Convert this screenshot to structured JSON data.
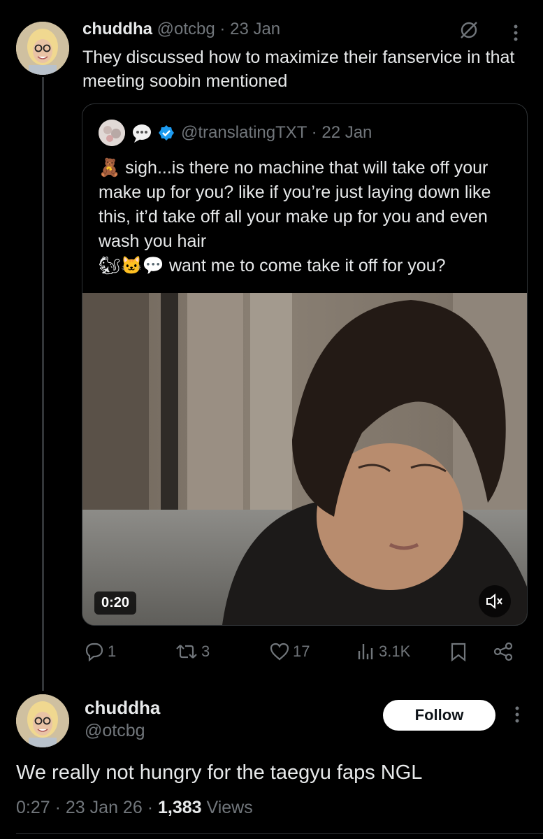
{
  "tweet1": {
    "display_name": "chuddha",
    "handle": "@otcbg",
    "separator": "·",
    "date": "23 Jan",
    "text": "They discussed how to maximize their fanservice in that meeting soobin mentioned"
  },
  "quote": {
    "handle": "@translatingTXT",
    "separator": "·",
    "date": "22 Jan",
    "line1_emoji": "🧸",
    "line1_text": "sigh...is there no machine that will take off your make up for you? like if you’re just laying down like this, it’d take off all your make up for you and even wash you hair",
    "line2_emoji": "🐿🐱💬",
    "line2_text": "want me to come take it off for you?",
    "video_duration": "0:20"
  },
  "actions": {
    "replies": "1",
    "reposts": "3",
    "likes": "17",
    "views": "3.1K"
  },
  "tweet2": {
    "display_name": "chuddha",
    "handle": "@otcbg",
    "follow_label": "Follow",
    "text": "We really not hungry for the taegyu faps NGL",
    "time": "0:27",
    "sep1": "·",
    "date": "23 Jan 26",
    "sep2": "·",
    "views_count": "1,383",
    "views_label": "Views"
  },
  "icons": {
    "reply": "reply-icon",
    "repost": "repost-icon",
    "like": "heart-icon",
    "views": "views-icon",
    "bookmark": "bookmark-icon",
    "share": "share-icon",
    "mute": "muted-speaker-icon",
    "verified": "verified-badge-icon",
    "grok": "grok-icon"
  },
  "colors": {
    "background": "#000000",
    "text": "#e7e9ea",
    "muted": "#71767b",
    "verified": "#1d9bf0"
  }
}
